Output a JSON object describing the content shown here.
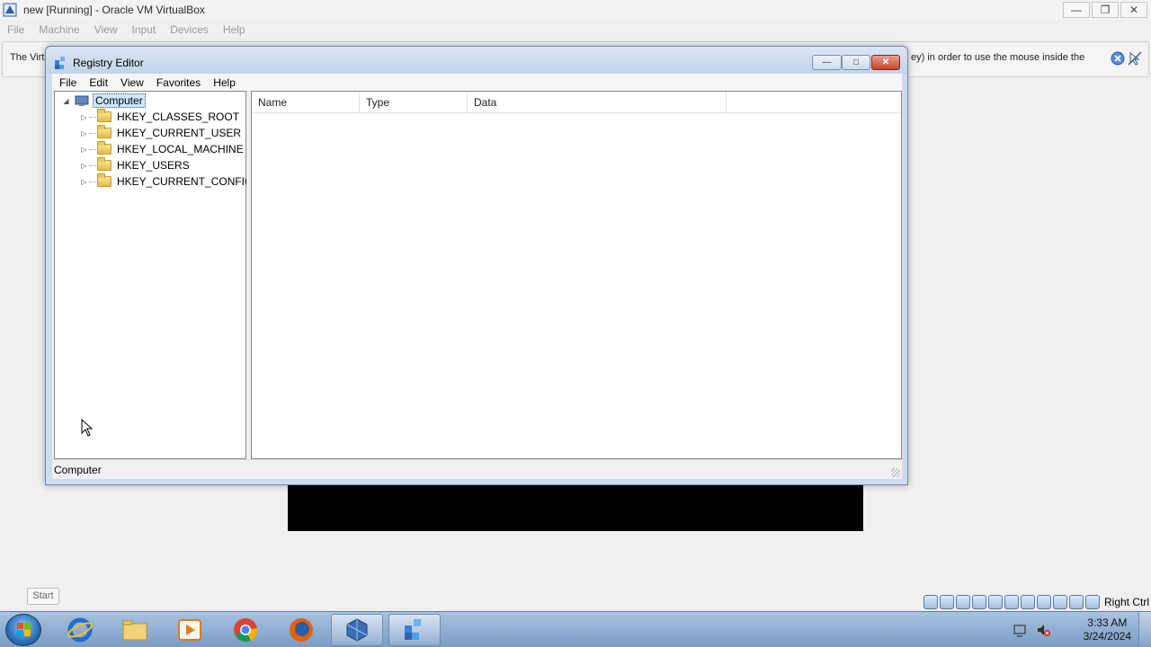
{
  "host": {
    "title": "new [Running] - Oracle VM VirtualBox",
    "menu": [
      "File",
      "Machine",
      "View",
      "Input",
      "Devices",
      "Help"
    ],
    "notice_left": "The Virtu",
    "notice_right": "ey) in order to use the mouse inside the",
    "window_controls": [
      "minimize",
      "restore",
      "close"
    ],
    "right_ctrl": "Right Ctrl"
  },
  "regedit": {
    "title": "Registry Editor",
    "menu": [
      "File",
      "Edit",
      "View",
      "Favorites",
      "Help"
    ],
    "tree_root": "Computer",
    "hives": [
      "HKEY_CLASSES_ROOT",
      "HKEY_CURRENT_USER",
      "HKEY_LOCAL_MACHINE",
      "HKEY_USERS",
      "HKEY_CURRENT_CONFIG"
    ],
    "columns": [
      "Name",
      "Type",
      "Data"
    ],
    "status": "Computer"
  },
  "tooltip": {
    "start": "Start"
  },
  "taskbar": {
    "items": [
      "internet-explorer",
      "windows-explorer",
      "media-player",
      "chrome",
      "firefox",
      "virtualbox",
      "registry-editor"
    ],
    "clock_time": "3:33 AM",
    "clock_date": "3/24/2024"
  }
}
